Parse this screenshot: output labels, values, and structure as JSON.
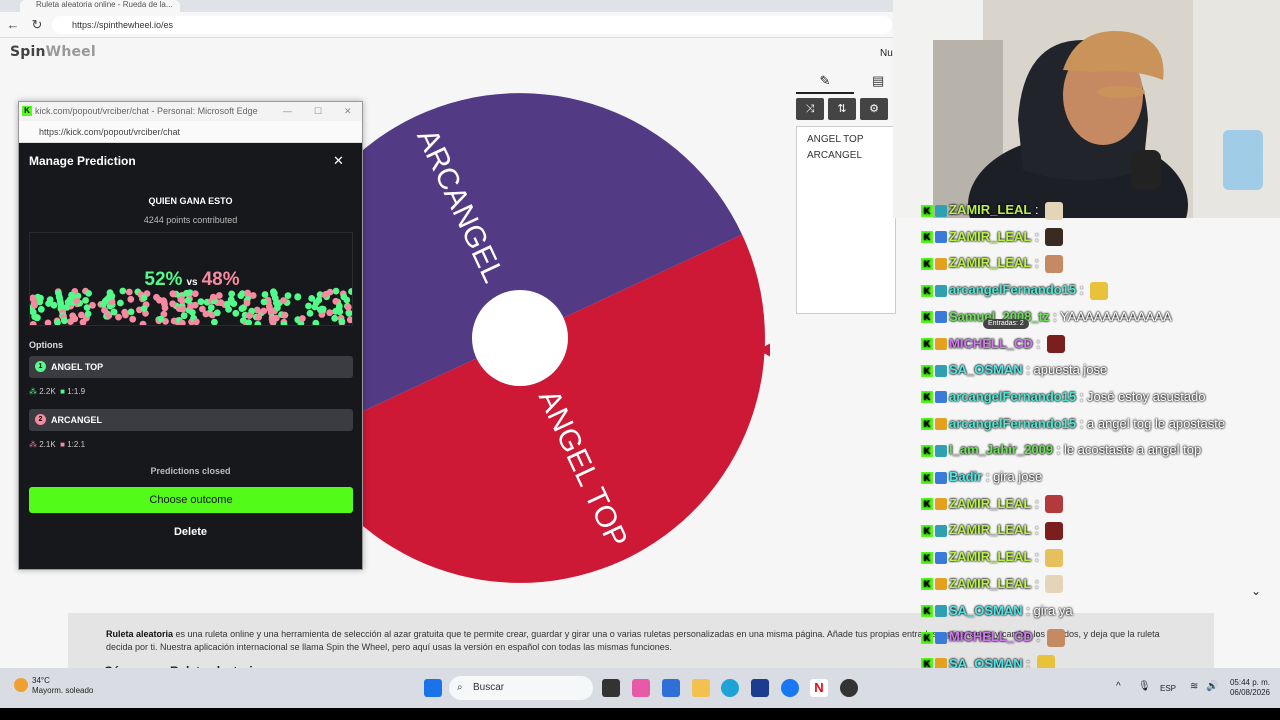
{
  "browser": {
    "tab_label": "Ruleta aleatoria online - Rueda de la...",
    "url": "https://spinthewheel.io/es"
  },
  "site": {
    "logo_prefix": "Spin",
    "logo_suffix": "Wheel",
    "top_right_label": "Nu"
  },
  "wheel": {
    "entries": [
      "ANGEL TOP",
      "ARCANGEL"
    ],
    "colors": {
      "purple": "#533a84",
      "red": "#cd1836",
      "hub": "#ffffff",
      "pointer": "#cd1836"
    }
  },
  "description": {
    "bold_lead": "Ruleta aleatoria",
    "text": " es una ruleta online y una herramienta de selección al azar gratuita que te permite crear, guardar y girar una o varias ruletas personalizadas en una misma página. Añade tus propias entradas, aplica temas y cambia los sonidos, y deja que la ruleta decida por ti. Nuestra aplicación internacional se llama Spin the Wheel, pero aquí usas la versión en español con todas las mismas funciones.",
    "heading": "Cómo usar Ruleta aleatoria"
  },
  "popup": {
    "window_title": "kick.com/popout/vrciber/chat - Personal: Microsoft Edge",
    "url": "https://kick.com/popout/vrciber/chat",
    "title": "Manage Prediction",
    "question": "QUIEN GANA ESTO",
    "points": "4244 points contributed",
    "pct_a": "52%",
    "pct_vs": "vs",
    "pct_b": "48%",
    "share_a": 0.52,
    "options_label": "Options",
    "options": [
      {
        "num": "1",
        "label": "ANGEL TOP",
        "users": "2.2K",
        "ratio": "1:1.9"
      },
      {
        "num": "2",
        "label": "ARCANGEL",
        "users": "2.1K",
        "ratio": "1:2.1"
      }
    ],
    "closed_text": "Predictions closed",
    "choose_label": "Choose outcome",
    "delete_label": "Delete",
    "colors": {
      "green": "#53fc8a",
      "pink": "#f58aa0",
      "kick_green": "#53fc18"
    }
  },
  "chat": {
    "messages": [
      {
        "user": "ZAMIR_LEAL",
        "color": "#b8f04a",
        "text": "",
        "emote": true
      },
      {
        "user": "ZAMIR_LEAL",
        "color": "#b8f04a",
        "text": "",
        "emote": true
      },
      {
        "user": "ZAMIR_LEAL",
        "color": "#b8f04a",
        "text": "",
        "emote": true
      },
      {
        "user": "arcangelFernando15",
        "color": "#4ee6d2",
        "text": "",
        "emote": true
      },
      {
        "user": "Samuel_2008_tz",
        "color": "#6ee05a",
        "text": "YAAAAAAAAAAAA",
        "emote": false
      },
      {
        "user": "MICHELL_CD",
        "color": "#d178f0",
        "text": "",
        "emote": true
      },
      {
        "user": "SA_OSMAN",
        "color": "#4ee6e6",
        "text": "apuesta jose",
        "emote": false
      },
      {
        "user": "arcangelFernando15",
        "color": "#4ee6d2",
        "text": "José estoy asustado",
        "emote": false
      },
      {
        "user": "arcangelFernando15",
        "color": "#4ee6d2",
        "text": "a angel tog le apostaste",
        "emote": false
      },
      {
        "user": "I_am_Jahir_2009",
        "color": "#6ee05a",
        "text": "le acostaste a angel top",
        "emote": false
      },
      {
        "user": "Badir",
        "color": "#4ee6e6",
        "text": "gira jose",
        "emote": false
      },
      {
        "user": "ZAMIR_LEAL",
        "color": "#b8f04a",
        "text": "",
        "emote": true
      },
      {
        "user": "ZAMIR_LEAL",
        "color": "#b8f04a",
        "text": "",
        "emote": true
      },
      {
        "user": "ZAMIR_LEAL",
        "color": "#b8f04a",
        "text": "",
        "emote": true
      },
      {
        "user": "ZAMIR_LEAL",
        "color": "#b8f04a",
        "text": "",
        "emote": true
      },
      {
        "user": "SA_OSMAN",
        "color": "#4ee6e6",
        "text": "gira ya",
        "emote": false
      },
      {
        "user": "MICHELL_CD",
        "color": "#d178f0",
        "text": "",
        "emote": true
      },
      {
        "user": "SA_OSMAN",
        "color": "#4ee6e6",
        "text": "",
        "emote": true
      }
    ],
    "hover_tag": "Entradas: 2"
  },
  "taskbar": {
    "temp": "34°C",
    "weather": "Mayorm. soleado",
    "search_placeholder": "Buscar",
    "lang": "ESP",
    "time": "05:44 p. m.",
    "date": "06/08/2026"
  }
}
